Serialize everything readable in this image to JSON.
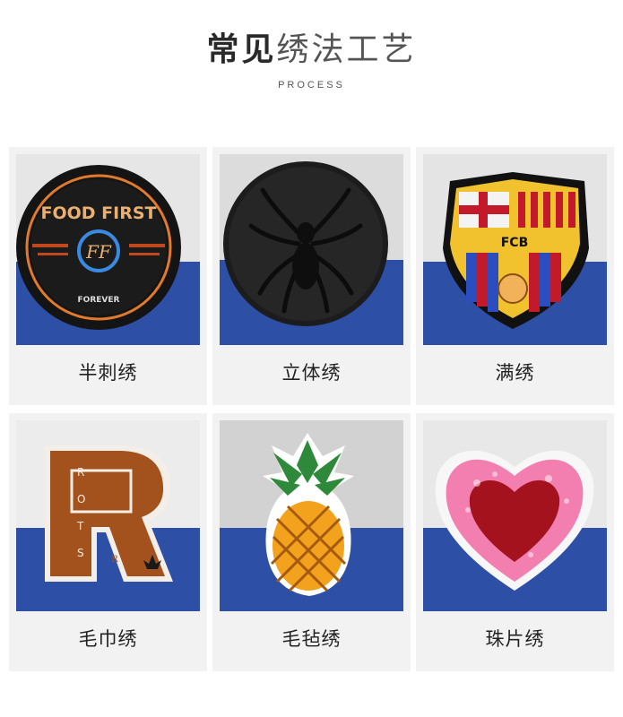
{
  "header": {
    "title_bold": "常见",
    "title_light": "绣法工艺",
    "subtitle": "PROCESS"
  },
  "items": [
    {
      "label": "半刺绣",
      "patch_text_top": "FOOD FIRST",
      "patch_text_mid": "FF",
      "patch_text_bottom": "FOREVER"
    },
    {
      "label": "立体绣"
    },
    {
      "label": "满绣",
      "patch_text": "FCB"
    },
    {
      "label": "毛巾绣",
      "patch_letter": "R",
      "patch_side_text": [
        "R",
        "O",
        "T",
        "S"
      ]
    },
    {
      "label": "毛毡绣"
    },
    {
      "label": "珠片绣"
    }
  ],
  "colors": {
    "card_bg": "#f2f2f2",
    "backdrop_blue": "#2f4fa8"
  }
}
